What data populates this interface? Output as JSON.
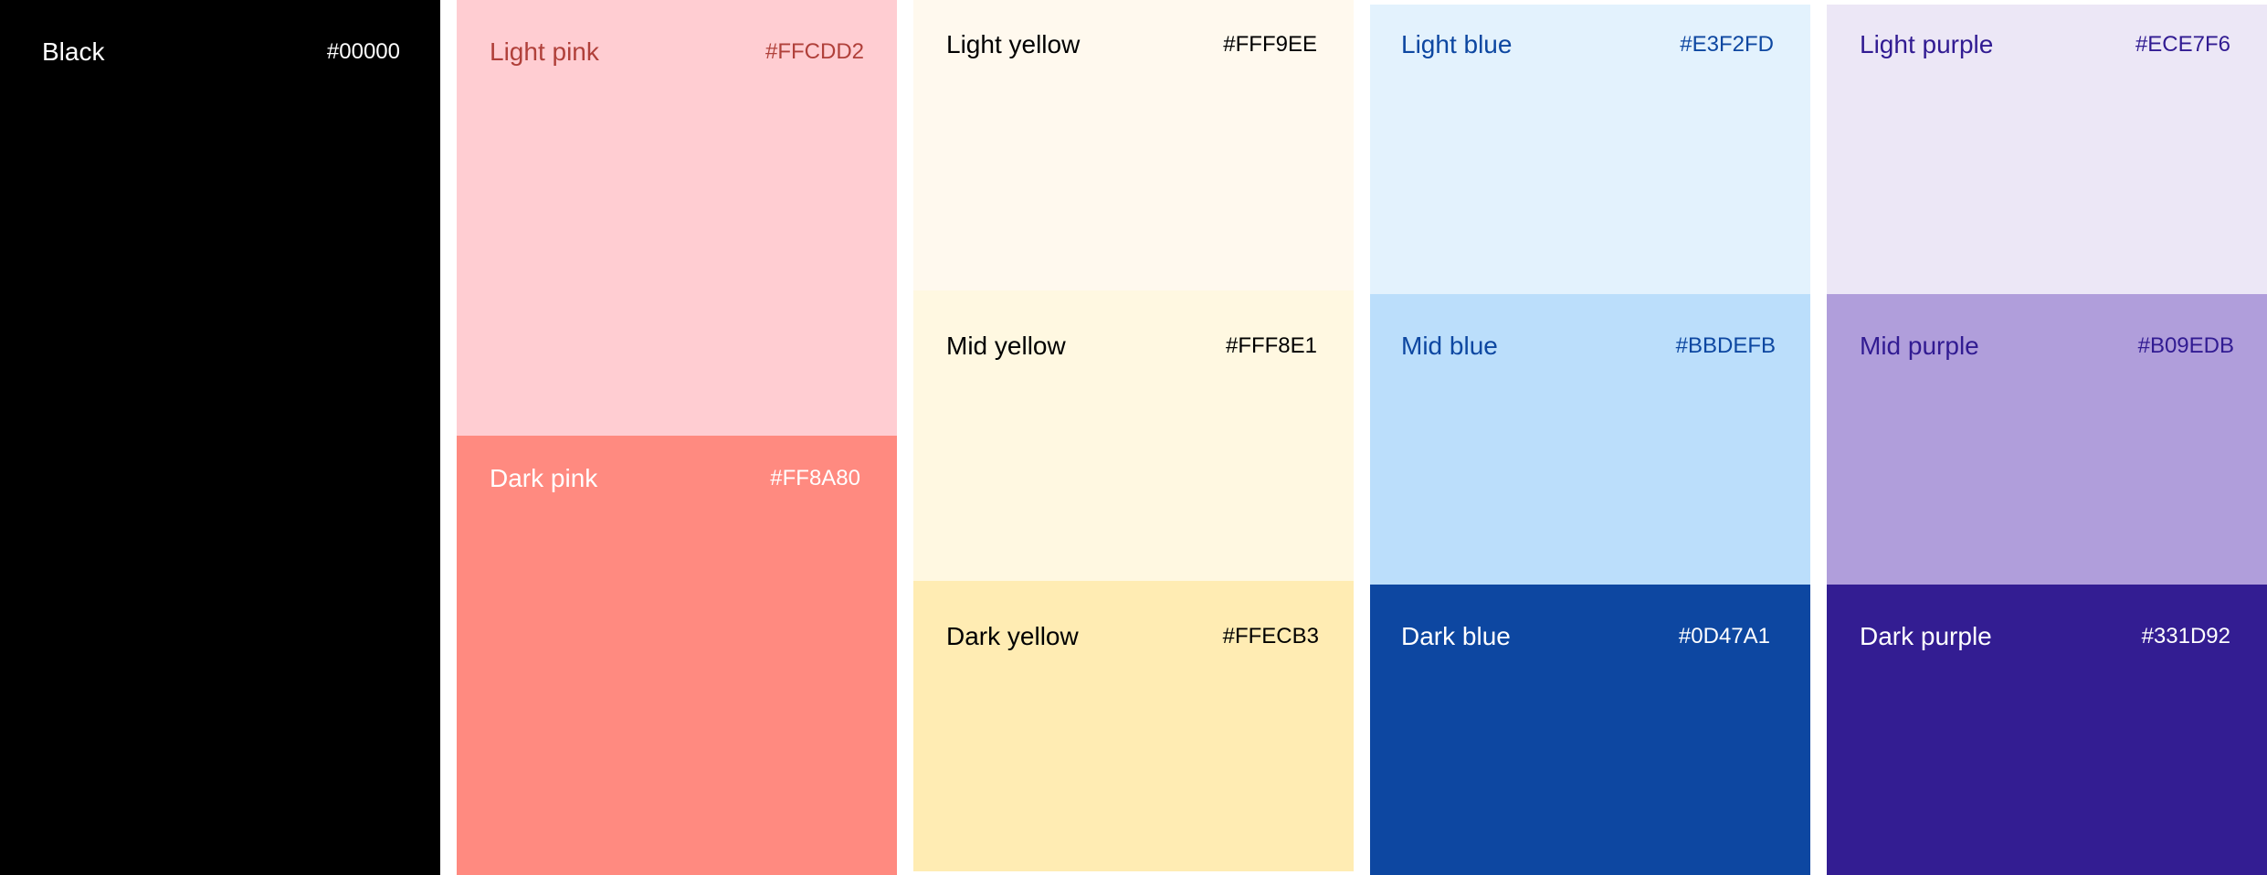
{
  "swatches": {
    "black": {
      "name": "Black",
      "hex": "#00000",
      "color": "#000000",
      "text_color": "#ffffff"
    },
    "light_pink": {
      "name": "Light pink",
      "hex": "#FFCDD2",
      "color": "#FFCDD2",
      "text_color": "#B0403A"
    },
    "dark_pink": {
      "name": "Dark pink",
      "hex": "#FF8A80",
      "color": "#FF8A80",
      "text_color": "#ffffff"
    },
    "light_yellow": {
      "name": "Light yellow",
      "hex": "#FFF9EE",
      "color": "#FFF9EE",
      "text_color": "#000000"
    },
    "mid_yellow": {
      "name": "Mid yellow",
      "hex": "#FFF8E1",
      "color": "#FFF8E1",
      "text_color": "#000000"
    },
    "dark_yellow": {
      "name": "Dark yellow",
      "hex": "#FFECB3",
      "color": "#FFECB3",
      "text_color": "#000000"
    },
    "light_blue": {
      "name": "Light blue",
      "hex": "#E3F2FD",
      "color": "#E3F2FD",
      "text_color": "#0D47A1"
    },
    "mid_blue": {
      "name": "Mid blue",
      "hex": "#BBDEFB",
      "color": "#BBDEFB",
      "text_color": "#0D47A1"
    },
    "dark_blue": {
      "name": "Dark blue",
      "hex": "#0D47A1",
      "color": "#0D47A1",
      "text_color": "#ffffff"
    },
    "light_purple": {
      "name": "Light purple",
      "hex": "#ECE7F6",
      "color": "#ECE7F6",
      "text_color": "#311B92"
    },
    "mid_purple": {
      "name": "Mid purple",
      "hex": "#B09EDB",
      "color": "#B09EDB",
      "text_color": "#311B92"
    },
    "dark_purple": {
      "name": "Dark purple",
      "hex": "#331D92",
      "color": "#331D92",
      "text_color": "#ffffff"
    }
  }
}
